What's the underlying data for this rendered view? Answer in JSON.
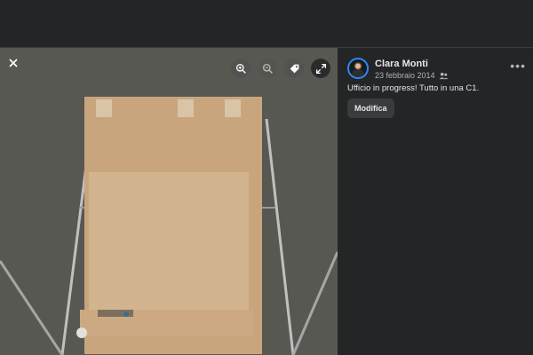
{
  "post": {
    "author": "Clara Monti",
    "date": "23 febbraio 2014",
    "caption": "Ufficio in progress! Tutto in una C1.",
    "edit_label": "Modifica"
  },
  "photo_toolbar": {
    "icons": [
      "zoom-in-icon",
      "zoom-out-icon",
      "tag-icon",
      "fullscreen-icon"
    ]
  },
  "colors": {
    "background": "#242526",
    "accent": "#2d88ff",
    "button": "#3a3b3c"
  }
}
